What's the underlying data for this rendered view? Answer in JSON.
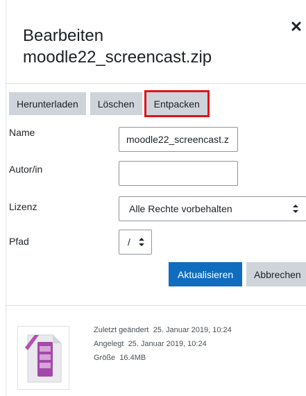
{
  "dialog": {
    "title_line1": "Bearbeiten",
    "title_line2": "moodle22_screencast.zip",
    "close_icon": "close-icon"
  },
  "toolbar": {
    "download_label": "Herunterladen",
    "delete_label": "Löschen",
    "unzip_label": "Entpacken",
    "highlight_color": "#e0131a"
  },
  "form": {
    "name_label": "Name",
    "name_value": "moodle22_screencast.z",
    "author_label": "Autor/in",
    "author_value": "",
    "license_label": "Lizenz",
    "license_value": "Alle Rechte vorbehalten",
    "path_label": "Pfad",
    "path_value": "/"
  },
  "actions": {
    "update_label": "Aktualisieren",
    "cancel_label": "Abbrechen",
    "primary_color": "#0f6cbf"
  },
  "file_info": {
    "icon": "archive-file-icon",
    "modified_label": "Zuletzt geändert",
    "modified_value": "25. Januar 2019, 10:24",
    "created_label": "Angelegt",
    "created_value": "25. Januar 2019, 10:24",
    "size_label": "Größe",
    "size_value": "16.4MB"
  }
}
